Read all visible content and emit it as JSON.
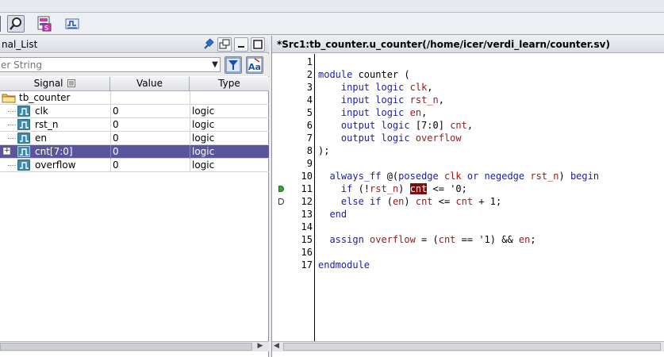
{
  "left_panel": {
    "title": "nal_List",
    "filter_placeholder": "er String",
    "columns": [
      "Signal",
      "Value",
      "Type"
    ],
    "scope": "tb_counter",
    "rows": [
      {
        "name": "clk",
        "value": "0",
        "type": "logic"
      },
      {
        "name": "rst_n",
        "value": "0",
        "type": "logic"
      },
      {
        "name": "en",
        "value": "0",
        "type": "logic"
      },
      {
        "name": "cnt[7:0]",
        "value": "0",
        "type": "logic"
      },
      {
        "name": "overflow",
        "value": "0",
        "type": "logic"
      }
    ]
  },
  "right_panel": {
    "title": "*Src1:tb_counter.u_counter(/home/icer/verdi_learn/counter.sv)"
  },
  "code": {
    "line_numbers": [
      "1",
      "2",
      "3",
      "4",
      "5",
      "6",
      "7",
      "8",
      "9",
      "10",
      "11",
      "12",
      "13",
      "14",
      "15",
      "16",
      "17"
    ],
    "l2_a": "module",
    "l2_b": " counter (",
    "l3_a": "    input",
    "l3_b": " logic",
    "l3_c": " clk",
    "l3_d": ",",
    "l4_a": "    input",
    "l4_b": " logic",
    "l4_c": " rst_n",
    "l4_d": ",",
    "l5_a": "    input",
    "l5_b": " logic",
    "l5_c": " en",
    "l5_d": ",",
    "l6_a": "    output",
    "l6_b": " logic",
    "l6_c": " [7:0] ",
    "l6_d": "cnt",
    "l6_e": ",",
    "l7_a": "    output",
    "l7_b": " logic",
    "l7_c": " overflow",
    "l8": ");",
    "l10_a": "  always_ff",
    "l10_b": " @(",
    "l10_c": "posedge",
    "l10_d": " clk ",
    "l10_e": "or",
    "l10_f": " negedge",
    "l10_g": " rst_n",
    "l10_h": ") ",
    "l10_i": "begin",
    "l11_a": "    if",
    "l11_b": " (!",
    "l11_c": "rst_n",
    "l11_d": ") ",
    "l11_e": "cnt",
    "l11_f": " <= '0;",
    "l12_a": "    else",
    "l12_b": " if",
    "l12_c": " (",
    "l12_d": "en",
    "l12_e": ") ",
    "l12_f": "cnt",
    "l12_g": " <= ",
    "l12_h": "cnt",
    "l12_i": " + 1;",
    "l13": "  end",
    "l15_a": "  assign",
    "l15_b": " overflow",
    "l15_c": " = (",
    "l15_d": "cnt",
    "l15_e": " == '1) && ",
    "l15_f": "en",
    "l15_g": ";",
    "l17": "endmodule"
  },
  "icons": {
    "toolbar": [
      "search-icon",
      "signal-list-icon",
      "waveform-icon"
    ],
    "left_window": [
      "pin-icon",
      "undock-icon",
      "minimize-icon",
      "maximize-icon"
    ],
    "filter": [
      "filter-icon",
      "match-case-icon"
    ],
    "grid": [
      "folder-icon",
      "signal-icon",
      "expand-icon",
      "sort-icon"
    ],
    "gutter": [
      "breakpoint-active-icon",
      "breakpoint-icon"
    ]
  },
  "colors": {
    "selection": "#5b559d",
    "keyword": "#1a1ab5",
    "identifier": "#a01818",
    "highlight": "#7a0f0f"
  }
}
